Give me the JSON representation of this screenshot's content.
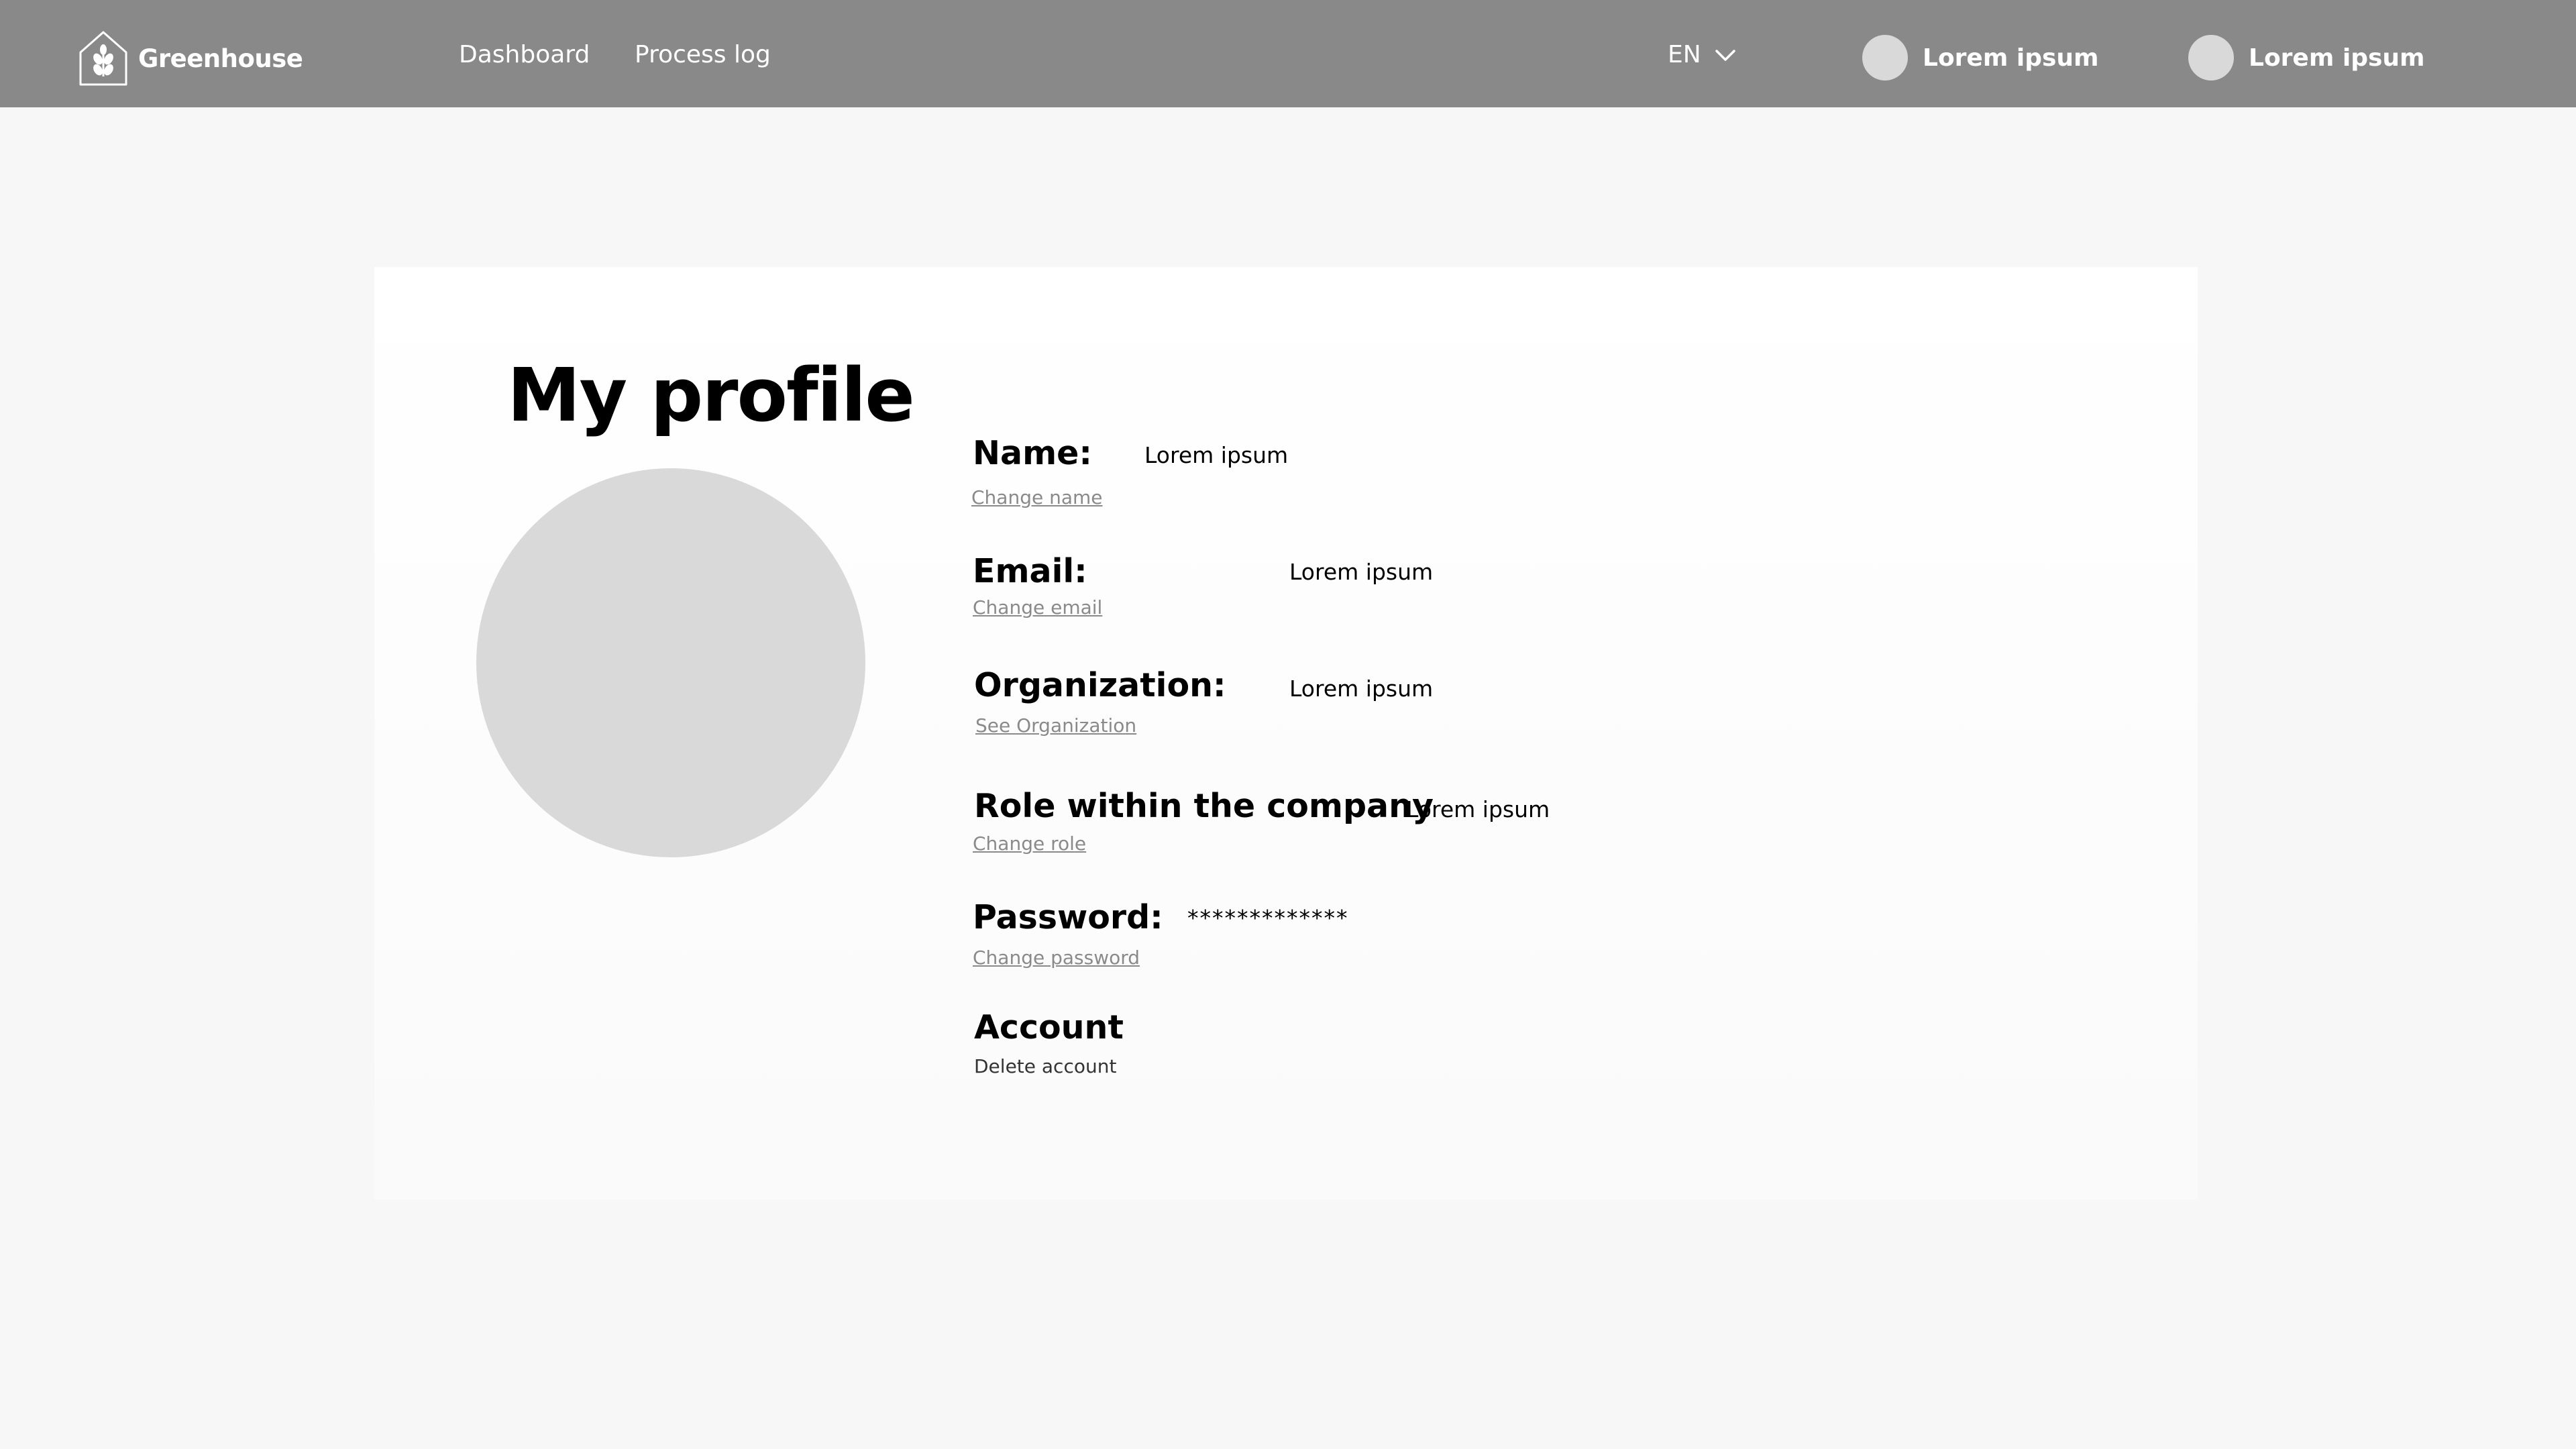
{
  "header": {
    "logo_text": "Greenhouse",
    "logo_icon": "greenhouse-leaf-icon",
    "nav": [
      {
        "label": "Dashboard"
      },
      {
        "label": "Process log"
      }
    ],
    "language": {
      "selected": "EN",
      "icon": "chevron-down-icon"
    },
    "users": [
      {
        "name": "Lorem ipsum"
      },
      {
        "name": "Lorem ipsum"
      }
    ],
    "colors": {
      "bar": "#898989",
      "text": "#ffffff"
    }
  },
  "profile": {
    "title": "My profile",
    "fields": {
      "name": {
        "label": "Name:",
        "value": "Lorem ipsum",
        "link": "Change name"
      },
      "email": {
        "label": "Email:",
        "value": "Lorem ipsum",
        "link": "Change email"
      },
      "organization": {
        "label": "Organization:",
        "value": "Lorem ipsum",
        "link": "See Organization"
      },
      "role": {
        "label": "Role within the company",
        "value": "Lorem ipsum",
        "link": "Change role"
      },
      "password": {
        "label": "Password:",
        "value": "*************",
        "link": "Change password"
      },
      "account": {
        "label": "Account",
        "link": "Delete account"
      }
    },
    "colors": {
      "avatar": "#d9d9d9",
      "link": "#8a8a8a",
      "background": "#f7f7f7",
      "card": "#ffffff"
    }
  }
}
